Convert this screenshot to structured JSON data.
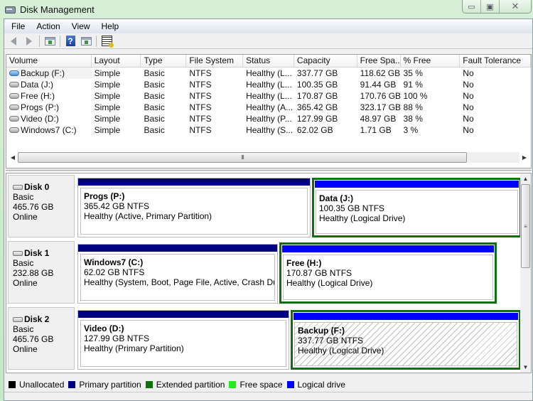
{
  "window": {
    "title": "Disk Management",
    "controls": {
      "minimize": "▭",
      "maximize": "▣",
      "close": "✕"
    }
  },
  "menu": [
    "File",
    "Action",
    "View",
    "Help"
  ],
  "toolbar": {
    "buttons": [
      "back-icon",
      "forward-icon",
      "show-hide-console-tree-icon",
      "help-icon",
      "show-hide-action-pane-icon",
      "properties-icon"
    ]
  },
  "volume_list": {
    "columns": [
      "Volume",
      "Layout",
      "Type",
      "File System",
      "Status",
      "Capacity",
      "Free Spa...",
      "% Free",
      "Fault Tolerance"
    ],
    "rows": [
      [
        "Backup (F:)",
        "Simple",
        "Basic",
        "NTFS",
        "Healthy (L...",
        "337.77 GB",
        "118.62 GB",
        "35 %",
        "No"
      ],
      [
        "Data (J:)",
        "Simple",
        "Basic",
        "NTFS",
        "Healthy (L...",
        "100.35 GB",
        "91.44 GB",
        "91 %",
        "No"
      ],
      [
        "Free (H:)",
        "Simple",
        "Basic",
        "NTFS",
        "Healthy (L...",
        "170.87 GB",
        "170.76 GB",
        "100 %",
        "No"
      ],
      [
        "Progs (P:)",
        "Simple",
        "Basic",
        "NTFS",
        "Healthy (A...",
        "365.42 GB",
        "323.17 GB",
        "88 %",
        "No"
      ],
      [
        "Video (D:)",
        "Simple",
        "Basic",
        "NTFS",
        "Healthy (P...",
        "127.99 GB",
        "48.97 GB",
        "38 %",
        "No"
      ],
      [
        "Windows7 (C:)",
        "Simple",
        "Basic",
        "NTFS",
        "Healthy (S...",
        "62.02 GB",
        "1.71 GB",
        "3 %",
        "No"
      ]
    ],
    "hscroll_grip": "III"
  },
  "disks": [
    {
      "name": "Disk 0",
      "type": "Basic",
      "size": "465.76 GB",
      "state": "Online",
      "partitions": [
        {
          "name": "Progs  (P:)",
          "size": "365.42 GB NTFS",
          "status": "Healthy (Active, Primary Partition)",
          "kind": "primary"
        },
        {
          "name": "Data  (J:)",
          "size": "100.35 GB NTFS",
          "status": "Healthy (Logical Drive)",
          "kind": "logical"
        }
      ]
    },
    {
      "name": "Disk 1",
      "type": "Basic",
      "size": "232.88 GB",
      "state": "Online",
      "partitions": [
        {
          "name": "Windows7  (C:)",
          "size": "62.02 GB NTFS",
          "status": "Healthy (System, Boot, Page File, Active, Crash Dump,",
          "kind": "primary"
        },
        {
          "name": "Free  (H:)",
          "size": "170.87 GB NTFS",
          "status": "Healthy (Logical Drive)",
          "kind": "logical"
        }
      ]
    },
    {
      "name": "Disk 2",
      "type": "Basic",
      "size": "465.76 GB",
      "state": "Online",
      "partitions": [
        {
          "name": "Video  (D:)",
          "size": "127.99 GB NTFS",
          "status": "Healthy (Primary Partition)",
          "kind": "primary"
        },
        {
          "name": "Backup  (F:)",
          "size": "337.77 GB NTFS",
          "status": "Healthy (Logical Drive)",
          "kind": "logical",
          "selected": true
        }
      ]
    }
  ],
  "vscroll_grip": "≡",
  "legend": [
    {
      "label": "Unallocated",
      "color": "#000000"
    },
    {
      "label": "Primary partition",
      "color": "#000080"
    },
    {
      "label": "Extended partition",
      "color": "#107010"
    },
    {
      "label": "Free space",
      "color": "#22ee22"
    },
    {
      "label": "Logical drive",
      "color": "#0000ff"
    }
  ]
}
